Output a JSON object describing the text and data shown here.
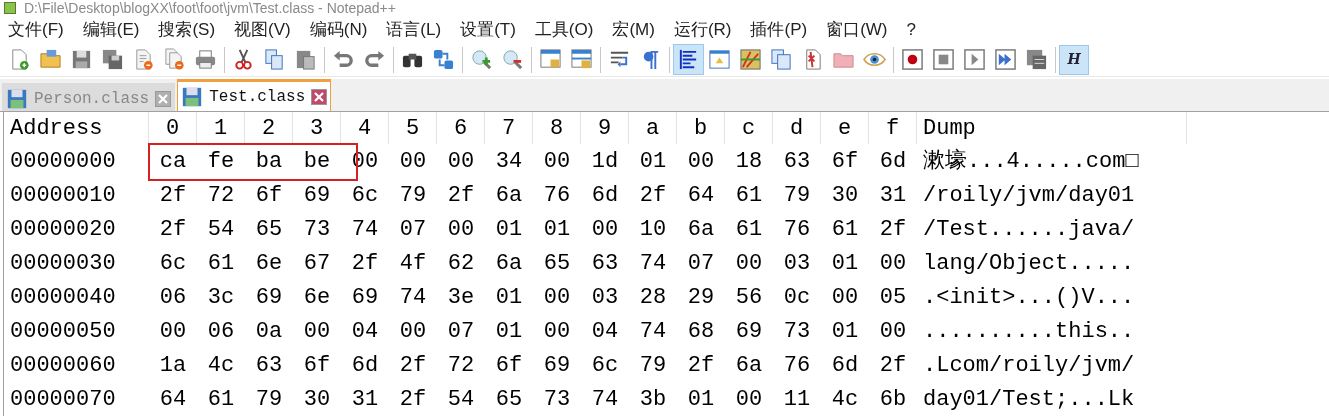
{
  "window": {
    "title": "D:\\File\\Desktop\\blogXX\\foot\\foot\\jvm\\Test.class - Notepad++"
  },
  "menu": [
    "文件(F)",
    "编辑(E)",
    "搜索(S)",
    "视图(V)",
    "编码(N)",
    "语言(L)",
    "设置(T)",
    "工具(O)",
    "宏(M)",
    "运行(R)",
    "插件(P)",
    "窗口(W)",
    "?"
  ],
  "toolbar": [
    {
      "kind": "new",
      "on": false
    },
    {
      "kind": "open",
      "on": false
    },
    {
      "kind": "save",
      "on": false
    },
    {
      "kind": "saveall",
      "on": false
    },
    {
      "kind": "close",
      "on": false
    },
    {
      "kind": "closeall",
      "on": false
    },
    {
      "kind": "print",
      "on": false
    },
    {
      "kind": "separator"
    },
    {
      "kind": "cut",
      "on": false
    },
    {
      "kind": "copy",
      "on": false
    },
    {
      "kind": "paste",
      "on": false
    },
    {
      "kind": "separator"
    },
    {
      "kind": "undo",
      "on": false
    },
    {
      "kind": "redo",
      "on": false
    },
    {
      "kind": "separator"
    },
    {
      "kind": "find",
      "on": false
    },
    {
      "kind": "replace",
      "on": false
    },
    {
      "kind": "separator"
    },
    {
      "kind": "zoomin",
      "on": false
    },
    {
      "kind": "zoomout",
      "on": false
    },
    {
      "kind": "separator"
    },
    {
      "kind": "syncv",
      "on": false
    },
    {
      "kind": "synch",
      "on": false
    },
    {
      "kind": "separator"
    },
    {
      "kind": "wrap",
      "on": false
    },
    {
      "kind": "pilcrow",
      "on": false
    },
    {
      "kind": "separator"
    },
    {
      "kind": "indent",
      "on": true
    },
    {
      "kind": "panel",
      "on": false
    },
    {
      "kind": "map",
      "on": false
    },
    {
      "kind": "docs",
      "on": false
    },
    {
      "kind": "func",
      "on": false
    },
    {
      "kind": "folder",
      "on": false
    },
    {
      "kind": "eye",
      "on": false
    },
    {
      "kind": "separator"
    },
    {
      "kind": "record",
      "on": false
    },
    {
      "kind": "stop",
      "on": false
    },
    {
      "kind": "play",
      "on": false
    },
    {
      "kind": "playmulti",
      "on": false
    },
    {
      "kind": "savemacro",
      "on": false
    },
    {
      "kind": "separator"
    },
    {
      "kind": "text",
      "label": "H",
      "on": true
    }
  ],
  "tabs": [
    {
      "label": "Person.class",
      "selected": false
    },
    {
      "label": "Test.class",
      "selected": true
    }
  ],
  "hex": {
    "columns": [
      "Address",
      "0",
      "1",
      "2",
      "3",
      "4",
      "5",
      "6",
      "7",
      "8",
      "9",
      "a",
      "b",
      "c",
      "d",
      "e",
      "f",
      "Dump"
    ],
    "rows": [
      {
        "address": "00000000",
        "bytes": [
          "ca",
          "fe",
          "ba",
          "be",
          "00",
          "00",
          "00",
          "34",
          "00",
          "1d",
          "01",
          "00",
          "18",
          "63",
          "6f",
          "6d"
        ],
        "dump": "漱壕...4.....com□",
        "highlighted": true
      },
      {
        "address": "00000010",
        "bytes": [
          "2f",
          "72",
          "6f",
          "69",
          "6c",
          "79",
          "2f",
          "6a",
          "76",
          "6d",
          "2f",
          "64",
          "61",
          "79",
          "30",
          "31"
        ],
        "dump": "/roily/jvm/day01",
        "highlighted": false
      },
      {
        "address": "00000020",
        "bytes": [
          "2f",
          "54",
          "65",
          "73",
          "74",
          "07",
          "00",
          "01",
          "01",
          "00",
          "10",
          "6a",
          "61",
          "76",
          "61",
          "2f"
        ],
        "dump": "/Test......java/",
        "highlighted": false
      },
      {
        "address": "00000030",
        "bytes": [
          "6c",
          "61",
          "6e",
          "67",
          "2f",
          "4f",
          "62",
          "6a",
          "65",
          "63",
          "74",
          "07",
          "00",
          "03",
          "01",
          "00"
        ],
        "dump": "lang/Object.....",
        "highlighted": false
      },
      {
        "address": "00000040",
        "bytes": [
          "06",
          "3c",
          "69",
          "6e",
          "69",
          "74",
          "3e",
          "01",
          "00",
          "03",
          "28",
          "29",
          "56",
          "0c",
          "00",
          "05"
        ],
        "dump": ".<init>...()V...",
        "highlighted": false
      },
      {
        "address": "00000050",
        "bytes": [
          "00",
          "06",
          "0a",
          "00",
          "04",
          "00",
          "07",
          "01",
          "00",
          "04",
          "74",
          "68",
          "69",
          "73",
          "01",
          "00"
        ],
        "dump": "..........this..",
        "highlighted": false
      },
      {
        "address": "00000060",
        "bytes": [
          "1a",
          "4c",
          "63",
          "6f",
          "6d",
          "2f",
          "72",
          "6f",
          "69",
          "6c",
          "79",
          "2f",
          "6a",
          "76",
          "6d",
          "2f"
        ],
        "dump": ".Lcom/roily/jvm/",
        "highlighted": false
      },
      {
        "address": "00000070",
        "bytes": [
          "64",
          "61",
          "79",
          "30",
          "31",
          "2f",
          "54",
          "65",
          "73",
          "74",
          "3b",
          "01",
          "00",
          "11",
          "4c",
          "6b"
        ],
        "dump": "day01/Test;...Lk",
        "highlighted": false
      }
    ]
  }
}
